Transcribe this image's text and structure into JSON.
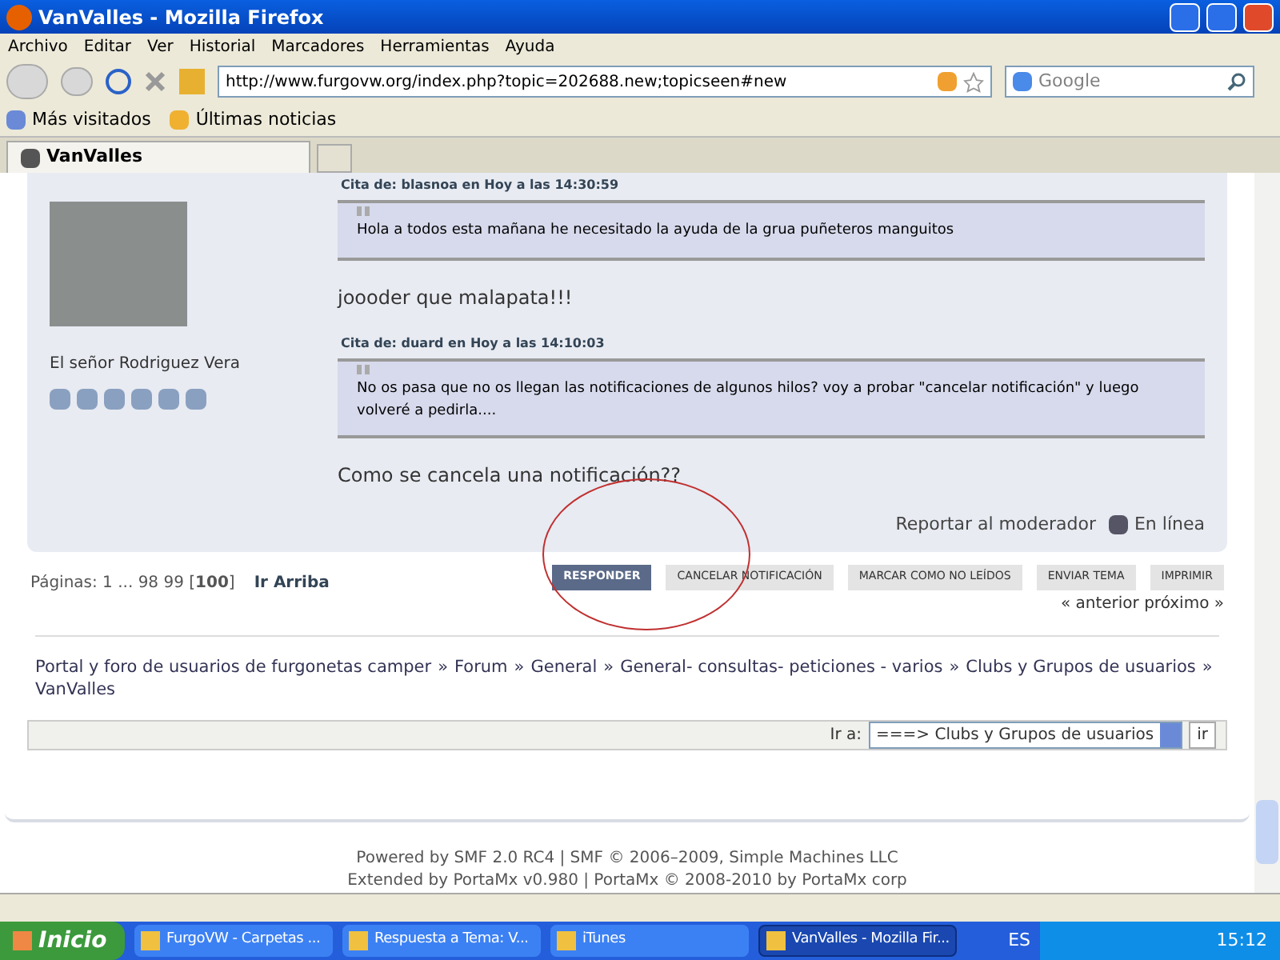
{
  "window": {
    "title": "VanValles - Mozilla Firefox"
  },
  "menu": [
    "Archivo",
    "Editar",
    "Ver",
    "Historial",
    "Marcadores",
    "Herramientas",
    "Ayuda"
  ],
  "address": {
    "value": "http://www.furgovw.org/index.php?topic=202688.new;topicseen#new"
  },
  "search": {
    "placeholder": "Google"
  },
  "bookmarks": [
    "Más visitados",
    "Últimas noticias"
  ],
  "tabs": [
    {
      "label": "VanValles",
      "selected": true
    }
  ],
  "post": {
    "author": "El señor Rodriguez Vera",
    "quotes": [
      {
        "header": "Cita de: blasnoa en Hoy a las 14:30:59",
        "text": "Hola a todos esta mañana he necesitado la ayuda de la grua puñeteros manguitos",
        "reply": "joooder que malapata!!!"
      },
      {
        "header": "Cita de: duard en Hoy a las 14:10:03",
        "text": "No os pasa que no os llegan las notificaciones de algunos hilos? voy a probar \"cancelar notificación\" y luego volveré a pedirla....",
        "reply": "Como se cancela una notificación??"
      }
    ],
    "report": "Reportar al moderador",
    "online": "En línea"
  },
  "pages": {
    "label": "Páginas: 1 ... 98 99 [",
    "current": "100",
    "end": "]",
    "top": "Ir Arriba"
  },
  "buttons": [
    {
      "label": "RESPONDER",
      "selected": true
    },
    {
      "label": "CANCELAR NOTIFICACIÓN",
      "selected": false
    },
    {
      "label": "MARCAR COMO NO LEÍDOS",
      "selected": false
    },
    {
      "label": "ENVIAR TEMA",
      "selected": false
    },
    {
      "label": "IMPRIMIR",
      "selected": false
    }
  ],
  "prev_next": "« anterior próximo »",
  "breadcrumb_separator": "»",
  "breadcrumb": [
    "Portal y foro de usuarios de furgonetas camper",
    "Forum",
    "General",
    "General- consultas- peticiones - varios",
    "Clubs y Grupos de usuarios",
    "VanValles"
  ],
  "jump": {
    "label": "Ir a:",
    "value": "===> Clubs y Grupos de usuarios",
    "button": "ir"
  },
  "footer": [
    "Powered by SMF 2.0 RC4 | SMF © 2006–2009, Simple Machines LLC",
    "Extended by PortaMx v0.980 | PortaMx © 2008-2010 by PortaMx corp"
  ],
  "taskbar": {
    "start": "Inicio",
    "items": [
      {
        "label": "FurgoVW - Carpetas ...",
        "selected": false
      },
      {
        "label": "Respuesta a Tema: V...",
        "selected": false
      },
      {
        "label": "iTunes",
        "selected": false
      },
      {
        "label": "VanValles - Mozilla Fir...",
        "selected": true
      }
    ],
    "lang": "ES",
    "clock": "15:12"
  }
}
